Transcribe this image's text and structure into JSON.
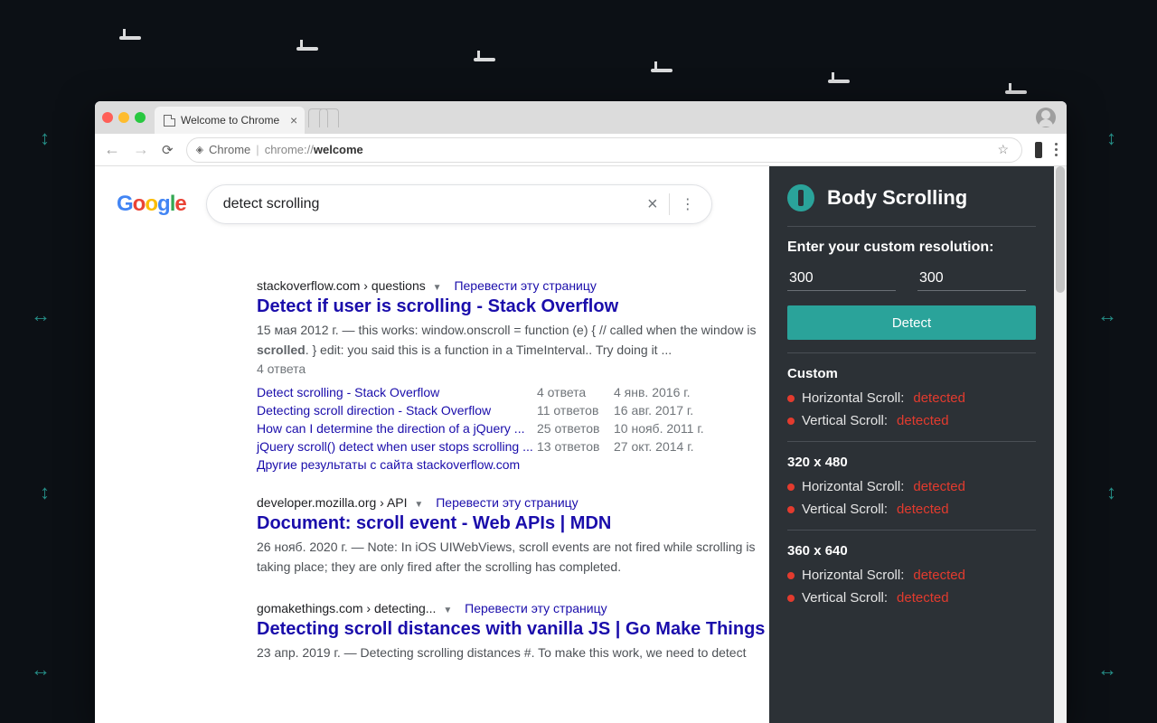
{
  "browser": {
    "tab_title": "Welcome to Chrome",
    "address_host": "Chrome",
    "address_sep": "|",
    "address_path_prefix": "chrome://",
    "address_path_bold": "welcome"
  },
  "search": {
    "query": "detect scrolling"
  },
  "results": [
    {
      "crumb": "stackoverflow.com › questions",
      "translate": "Перевести эту страницу",
      "title": "Detect if user is scrolling - Stack Overflow",
      "snippet_pre": "15 мая 2012 г. — this works: window.onscroll = function (e) { // called when the window is ",
      "snippet_bold1": "scrolled",
      "snippet_post": ". } edit: you said this is a function in a TimeInterval.. Try doing it ...",
      "answers": "4 ответа",
      "related": [
        {
          "link": "Detect scrolling - Stack Overflow",
          "ans": "4 ответа",
          "date": "4 янв. 2016 г."
        },
        {
          "link": "Detecting scroll direction - Stack Overflow",
          "ans": "11 ответов",
          "date": "16 авг. 2017 г."
        },
        {
          "link": "How can I determine the direction of a jQuery ...",
          "ans": "25 ответов",
          "date": "10 нояб. 2011 г."
        },
        {
          "link": "jQuery scroll() detect when user stops scrolling ...",
          "ans": "13 ответов",
          "date": "27 окт. 2014 г."
        }
      ],
      "more": "Другие результаты с сайта stackoverflow.com"
    },
    {
      "crumb": "developer.mozilla.org › API",
      "translate": "Перевести эту страницу",
      "title": "Document: scroll event - Web APIs | MDN",
      "snippet": "26 нояб. 2020 г. — Note: In iOS UIWebViews, scroll events are not fired while scrolling is taking place; they are only fired after the scrolling has completed."
    },
    {
      "crumb": "gomakethings.com › detecting...",
      "translate": "Перевести эту страницу",
      "title": "Detecting scroll distances with vanilla JS | Go Make Things",
      "snippet": "23 апр. 2019 г. — Detecting scrolling distances #. To make this work, we need to detect"
    }
  ],
  "panel": {
    "title": "Body Scrolling",
    "label": "Enter your custom resolution:",
    "in1": "300",
    "in2": "300",
    "detect": "Detect",
    "sections": [
      {
        "name": "Custom",
        "h": "Horizontal Scroll:",
        "hv": "detected",
        "v": "Vertical Scroll:",
        "vv": "detected"
      },
      {
        "name": "320 x 480",
        "h": "Horizontal Scroll:",
        "hv": "detected",
        "v": "Vertical Scroll:",
        "vv": "detected"
      },
      {
        "name": "360 x 640",
        "h": "Horizontal Scroll:",
        "hv": "detected",
        "v": "Vertical Scroll:",
        "vv": "detected"
      }
    ]
  }
}
